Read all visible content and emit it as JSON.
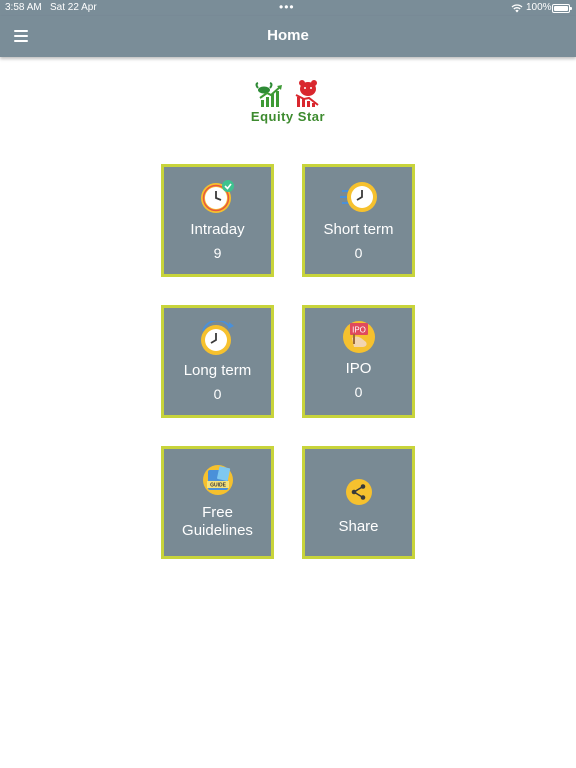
{
  "status_bar": {
    "time": "3:58 AM",
    "date": "Sat 22 Apr",
    "dots": "•••",
    "battery_pct": "100%"
  },
  "app_bar": {
    "title": "Home",
    "menu_icon": "hamburger-menu-icon"
  },
  "logo": {
    "word1": "Equity",
    "word2": "Star",
    "colors": {
      "bull": "#3d9a34",
      "bear": "#d9272e"
    }
  },
  "tiles": [
    {
      "label": "Intraday",
      "count": "9",
      "icon": "clock-check-icon"
    },
    {
      "label": "Short term",
      "count": "0",
      "icon": "clock-fast-icon"
    },
    {
      "label": "Long term",
      "count": "0",
      "icon": "clock-cycle-icon"
    },
    {
      "label": "IPO",
      "count": "0",
      "icon": "ipo-icon"
    },
    {
      "label_line1": "Free",
      "label_line2": "Guidelines",
      "icon": "guide-book-icon"
    },
    {
      "label": "Share",
      "icon": "share-icon"
    }
  ],
  "colors": {
    "bar": "#7a8d98",
    "tile": "#798a94",
    "tile_border": "#c8d43b",
    "icon_yellow": "#f6c12e"
  }
}
